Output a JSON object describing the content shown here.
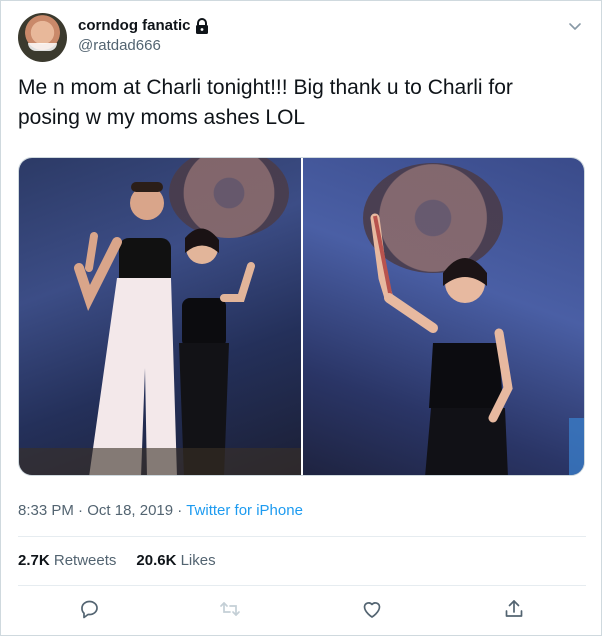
{
  "user": {
    "display_name": "corndog fanatic",
    "handle": "@ratdad666"
  },
  "tweet": {
    "text": "Me n mom at Charli tonight!!! Big thank u to Charli for posing w my moms ashes LOL"
  },
  "meta": {
    "time": "8:33 PM",
    "date": "Oct 18, 2019",
    "separator": "·",
    "client": "Twitter for iPhone"
  },
  "stats": {
    "retweets_count": "2.7K",
    "retweets_label": "Retweets",
    "likes_count": "20.6K",
    "likes_label": "Likes"
  },
  "icons": {
    "lock": "lock-icon",
    "chevron": "chevron-down-icon",
    "reply": "reply-icon",
    "retweet": "retweet-icon",
    "like": "heart-icon",
    "share": "share-icon"
  },
  "colors": {
    "link": "#1d9bf0",
    "secondary_text": "#536471",
    "retweet_disabled": "#c4cfd6"
  }
}
